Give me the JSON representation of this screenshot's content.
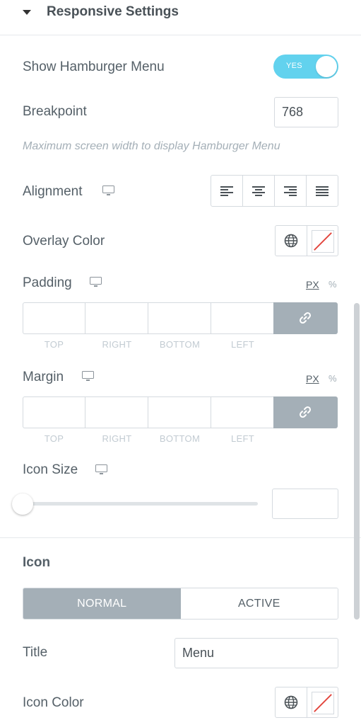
{
  "section": {
    "title": "Responsive Settings"
  },
  "hamburger": {
    "label": "Show Hamburger Menu",
    "toggle_text": "YES",
    "enabled": true
  },
  "breakpoint": {
    "label": "Breakpoint",
    "value": "768",
    "description": "Maximum screen width to display Hamburger Menu"
  },
  "alignment": {
    "label": "Alignment",
    "options": [
      "left",
      "center",
      "right",
      "justify"
    ]
  },
  "overlay_color": {
    "label": "Overlay Color"
  },
  "padding": {
    "label": "Padding",
    "units": [
      "PX",
      "%"
    ],
    "sides": [
      "TOP",
      "RIGHT",
      "BOTTOM",
      "LEFT"
    ]
  },
  "margin": {
    "label": "Margin",
    "units": [
      "PX",
      "%"
    ],
    "sides": [
      "TOP",
      "RIGHT",
      "BOTTOM",
      "LEFT"
    ]
  },
  "icon_size": {
    "label": "Icon Size",
    "value": ""
  },
  "icon_section": {
    "heading": "Icon",
    "tabs": [
      "NORMAL",
      "ACTIVE"
    ],
    "active_tab": "NORMAL"
  },
  "title_field": {
    "label": "Title",
    "value": "Menu"
  },
  "icon_color": {
    "label": "Icon Color"
  },
  "colors": {
    "toggle_on": "#62d2ee",
    "tab_active": "#a4afb7",
    "no_color_slash": "#e2453c"
  }
}
